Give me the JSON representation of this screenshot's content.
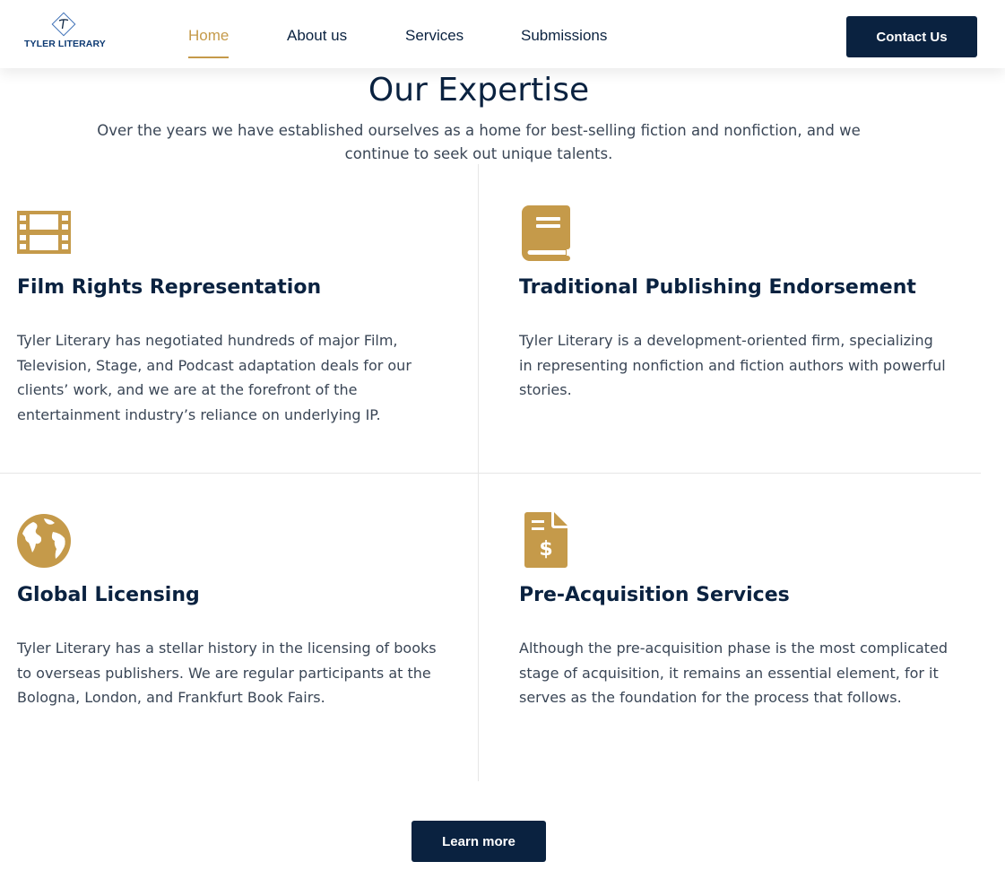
{
  "header": {
    "logo_text": "TYLER LITERARY",
    "nav": [
      {
        "label": "Home",
        "active": true
      },
      {
        "label": "About us",
        "active": false
      },
      {
        "label": "Services",
        "active": false
      },
      {
        "label": "Submissions",
        "active": false
      }
    ],
    "contact_label": "Contact Us"
  },
  "section": {
    "title": "Our Expertise",
    "subtitle": "Over the years we have established ourselves as a home for best-selling fiction and nonfiction, and we continue to seek out unique talents."
  },
  "cards": [
    {
      "icon": "film-icon",
      "title": "Film Rights Representation",
      "text": "Tyler Literary has negotiated hundreds of major Film, Television, Stage, and Podcast adaptation deals for our clients’ work, and we are at the forefront of the entertainment industry’s reliance on underlying IP."
    },
    {
      "icon": "book-icon",
      "title": "Traditional Publishing Endorsement",
      "text": "Tyler Literary is a development-oriented firm, specializing in representing nonfiction and fiction authors with powerful stories."
    },
    {
      "icon": "globe-icon",
      "title": "Global Licensing",
      "text": "Tyler Literary has a stellar history in the licensing of books to overseas publishers. We are regular participants at the Bologna, London, and Frankfurt Book Fairs."
    },
    {
      "icon": "invoice-dollar-icon",
      "title": "Pre-Acquisition Services",
      "text": "Although the pre-acquisition phase is the most complicated stage of acquisition, it remains an essential element, for it serves as the foundation for the process that follows."
    }
  ],
  "learn_more_label": "Learn more",
  "colors": {
    "navy": "#0a2240",
    "gold": "#c59a4a",
    "body_text": "#3a4656"
  }
}
